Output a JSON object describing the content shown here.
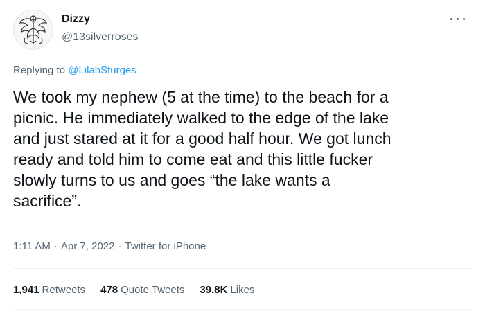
{
  "author": {
    "name": "Dizzy",
    "handle": "@13silverroses"
  },
  "reply": {
    "prefix": "Replying to",
    "mention": "@LilahSturges"
  },
  "tweet": {
    "text": "We took my nephew (5 at the time) to the beach for a\npicnic. He immediately walked to the edge of the lake\nand just stared at it for a good half hour. We got lunch\nready and told him to come eat and this little fucker\nslowly turns to us and goes “the lake wants a\nsacrifice”."
  },
  "meta": {
    "time": "1:11 AM",
    "date": "Apr 7, 2022",
    "source": "Twitter for iPhone",
    "separator": "·"
  },
  "stats": {
    "retweets_count": "1,941",
    "retweets_label": "Retweets",
    "quotes_count": "478",
    "quotes_label": "Quote Tweets",
    "likes_count": "39.8K",
    "likes_label": "Likes"
  },
  "icons": {
    "avatar": "ornate-emblem-avatar",
    "more": "more-horizontal-icon"
  },
  "colors": {
    "text_primary": "#0f1419",
    "text_secondary": "#536471",
    "link": "#1d9bf0",
    "divider": "#eff3f4"
  }
}
